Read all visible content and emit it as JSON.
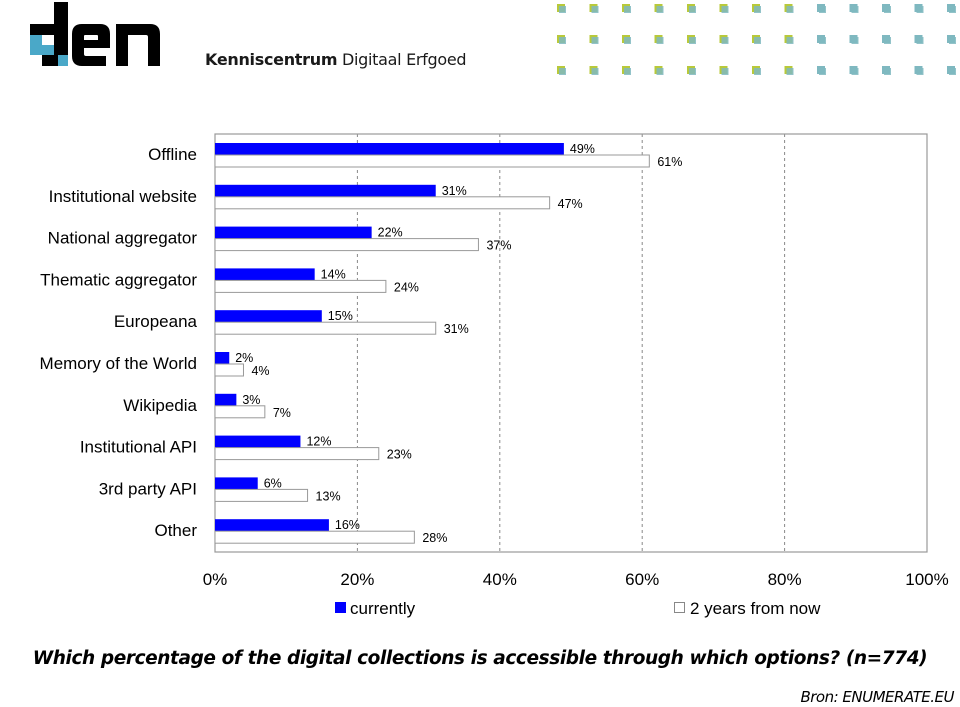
{
  "header": {
    "logo_text": "den",
    "tagline_bold": "Kenniscentrum",
    "tagline_regular": "Digitaal Erfgoed",
    "accent_color": "#4aa8c8",
    "dot_color_left": "#b8c93a",
    "dot_color_right": "#7fb8c0"
  },
  "chart_data": {
    "type": "bar",
    "orientation": "horizontal",
    "categories": [
      "Offline",
      "Institutional website",
      "National aggregator",
      "Thematic aggregator",
      "Europeana",
      "Memory of the World",
      "Wikipedia",
      "Institutional API",
      "3rd party API",
      "Other"
    ],
    "series": [
      {
        "name": "currently",
        "color": "#0000ff",
        "values": [
          49,
          31,
          22,
          14,
          15,
          2,
          3,
          12,
          6,
          16
        ]
      },
      {
        "name": "2 years from now",
        "color": "#ffffff",
        "values": [
          61,
          47,
          37,
          24,
          31,
          4,
          7,
          23,
          13,
          28
        ]
      }
    ],
    "value_labels": {
      "currently": [
        "49%",
        "31%",
        "22%",
        "14%",
        "15%",
        "2%",
        "3%",
        "12%",
        "6%",
        "16%"
      ],
      "2 years from now": [
        "61%",
        "47%",
        "37%",
        "24%",
        "31%",
        "4%",
        "7%",
        "23%",
        "13%",
        "28%"
      ]
    },
    "xlim": [
      0,
      100
    ],
    "xticks": [
      0,
      20,
      40,
      60,
      80,
      100
    ],
    "xtick_labels": [
      "0%",
      "20%",
      "40%",
      "60%",
      "80%",
      "100%"
    ],
    "grid": "vertical dashed",
    "legend": "bottom",
    "legend_entries": [
      "currently",
      "2 years from now"
    ],
    "title": "Which percentage of the digital collections is accessible through which options? (n=774)",
    "xlabel": "",
    "ylabel": ""
  },
  "footer": {
    "question": "Which percentage of the digital collections is accessible through which options? (n=774)",
    "source": "Bron: ENUMERATE.EU"
  }
}
